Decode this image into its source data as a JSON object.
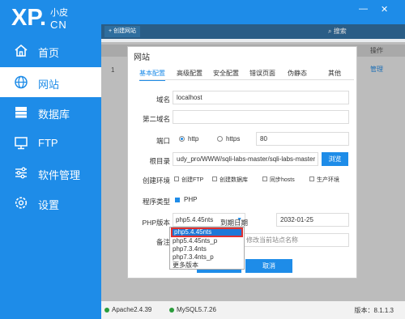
{
  "logo": {
    "main": "XP.",
    "cn_top": "小皮",
    "cn_bottom": "CN"
  },
  "nav": [
    {
      "label": "首页",
      "icon": "home-icon"
    },
    {
      "label": "网站",
      "icon": "globe-icon",
      "active": true
    },
    {
      "label": "数据库",
      "icon": "database-icon"
    },
    {
      "label": "FTP",
      "icon": "monitor-icon"
    },
    {
      "label": "软件管理",
      "icon": "sliders-icon"
    },
    {
      "label": "设置",
      "icon": "gear-icon"
    }
  ],
  "window": {
    "minimize": "—",
    "close": "✕"
  },
  "toolbar": {
    "create_label": "+ 创建网站",
    "search_placeholder": "搜索"
  },
  "table": {
    "col_operation": "操作",
    "row_number": "1",
    "manage_label": "管理"
  },
  "dialog": {
    "title": "网站",
    "tabs": [
      "基本配置",
      "高级配置",
      "安全配置",
      "错误页面",
      "伪静态",
      "其他"
    ],
    "fields": {
      "domain_label": "域名",
      "domain_value": "localhost",
      "second_domain_label": "第二域名",
      "second_domain_value": "",
      "port_label": "端口",
      "http_label": "http",
      "https_label": "https",
      "port_value": "80",
      "root_label": "根目录",
      "root_value": "udy_pro/WWW/sqli-labs-master/sqli-labs-master",
      "browse_label": "浏览",
      "env_label": "创建环境",
      "env_options": [
        "创建FTP",
        "创建数据库",
        "同步hosts",
        "生产环境"
      ],
      "type_label": "程序类型",
      "type_php": "PHP",
      "php_label": "PHP版本",
      "php_value": "php5.4.45nts",
      "expire_label": "到期日期",
      "expire_value": "2032-01-25",
      "note_label": "备注",
      "note_placeholder": "修改当前站点名称"
    },
    "php_options": [
      "php5.4.45nts",
      "php5.4.45nts_p",
      "php7.3.4nts",
      "php7.3.4nts_p",
      "更多版本"
    ],
    "cancel_label": "取消"
  },
  "status": {
    "apache": "Apache2.4.39",
    "mysql": "MySQL5.7.26",
    "version": "版本：8.1.1.3"
  },
  "colors": {
    "primary": "#1e8ce8",
    "selected": "#1e78d8",
    "highlight_border": "#e03030",
    "running": "#2b9c3c"
  }
}
